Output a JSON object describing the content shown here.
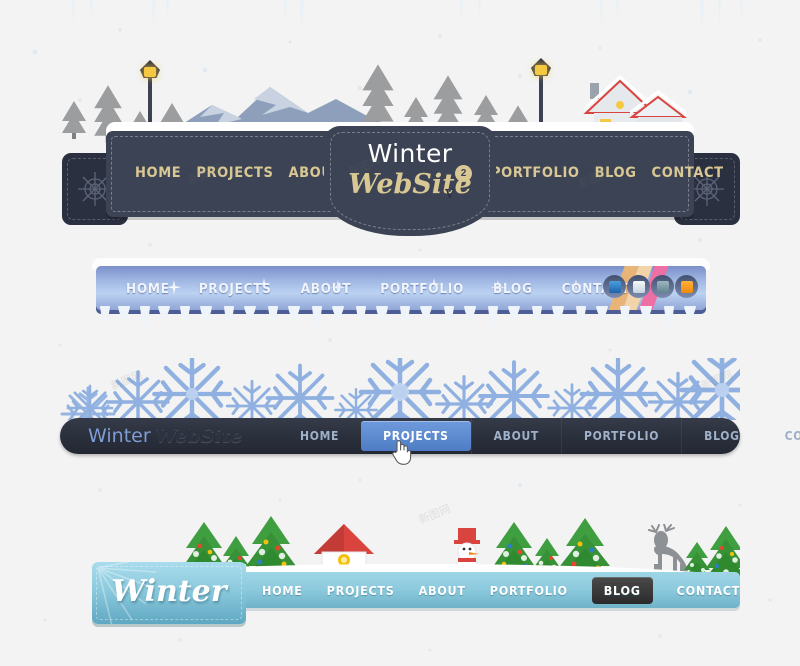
{
  "page": {
    "background_color": "#f2f3f2",
    "theme": "winter navigation bar collection"
  },
  "nav1": {
    "name": "dark-plaque-winter-nav",
    "brand_top": "Winter",
    "brand_bottom": "WebSite",
    "brand_v": "v",
    "brand_superscript": "2",
    "menu_left": [
      "HOME",
      "PROJECTS",
      "ABOUT"
    ],
    "menu_right": [
      "PORTFOLIO",
      "BLOG",
      "CONTACT"
    ],
    "colors": {
      "plaque": "#3c4354",
      "accent": "#d9c893",
      "tab": "#2b3040"
    },
    "scene": {
      "elements": [
        "mountain",
        "lamp-post",
        "pine-trees",
        "snow-house",
        "icicles",
        "falling-snow"
      ],
      "house_roof_color": "#d9443f",
      "lamp_light_color": "#f5c842"
    },
    "side_tabs": [
      "snowflake-left",
      "snowflake-right"
    ]
  },
  "nav2": {
    "name": "blue-gradient-nav",
    "menu": [
      "HOME",
      "PROJECTS",
      "ABOUT",
      "PORTFOLIO",
      "BLOG",
      "CONTACT"
    ],
    "buttons": [
      {
        "name": "button-blue",
        "color": "#2d7ec4"
      },
      {
        "name": "button-white",
        "color": "#e4ecf4"
      },
      {
        "name": "button-teal",
        "color": "#7fa0ac"
      },
      {
        "name": "button-orange",
        "color": "#f29219"
      }
    ],
    "ribbon_colors": [
      "#e8b477",
      "#ee6fa4"
    ],
    "colors": {
      "bar_top": "#7b8fc9",
      "bar_mid": "#bcd2f2",
      "shadow": "#4d5e96"
    },
    "decor": [
      "snow-cap-top",
      "icicles-bottom",
      "sparkle-stars"
    ]
  },
  "nav3": {
    "name": "snowflake-band-nav",
    "brand_first": "Winter",
    "brand_second": "WebSite",
    "menu": [
      "HOME",
      "PROJECTS",
      "ABOUT",
      "PORTFOLIO",
      "BLOG",
      "CONTACT"
    ],
    "active_item": "PROJECTS",
    "cursor": "pointing-hand",
    "colors": {
      "bar": "#2b303d",
      "brand_first": "#7e9dd4",
      "active": "#4e7cc4",
      "flake": "#8fb0e0"
    },
    "decor": [
      "snowflake-band"
    ]
  },
  "nav4": {
    "name": "light-blue-christmas-nav",
    "badge_label": "Winter",
    "menu": [
      "HOME",
      "PROJECTS",
      "ABOUT",
      "PORTFOLIO",
      "BLOG",
      "CONTACT"
    ],
    "active_item": "BLOG",
    "colors": {
      "bar": "#8ccadd",
      "badge": "#8ccadd",
      "active": "#2b2b2b"
    },
    "scene": {
      "elements": [
        "christmas-trees",
        "red-roof-house",
        "snowman",
        "deer",
        "snow-ridge",
        "falling-snow"
      ],
      "tree_color": "#3f9e3f",
      "house_roof_color": "#d9443f",
      "snowman_hat_color": "#d9443f",
      "deer_color": "#8d9094"
    }
  },
  "watermarks": [
    "新图网",
    "新图网",
    "新图网",
    "新图网",
    "新图网",
    "新图网"
  ]
}
